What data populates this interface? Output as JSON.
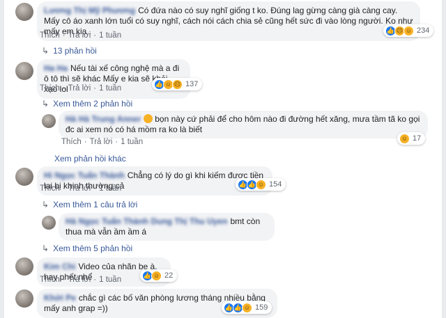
{
  "labels": {
    "like": "Thích",
    "reply": "Trả lời",
    "dot": "·"
  },
  "comments": [
    {
      "name": "Lương Thị Mỹ Phương",
      "text": "Có đứa nào có suy nghĩ giống t ko. Đúng lag gừng càng già càng cay. Mấy cô áo xanh lớn tuổi có suy nghĩ, cách nói cách chia sẻ cũng hết sức đi vào lòng người. Ko như mấy em kia .",
      "time": "1 tuần",
      "reactions": "234"
    },
    {
      "name": "Ha Ha",
      "text": "Nếu tài xế công nghệ mà a đi ô tô thì sẽ khác Mấy e kia sẽ khỏi xạo lol",
      "time": "1 tuần",
      "reactions": "137"
    },
    {
      "name": "Hi Ngọc Tuấn Thành",
      "text": "Chẳng có lý do gì khi kiếm được tiền lại bị khinh thường cả",
      "time": "1 tuần",
      "reactions": "154"
    },
    {
      "name": "Kim Chi",
      "text": "Video của nhãn be à, hay phết nhể",
      "time": "1 tuần",
      "reactions": "22"
    },
    {
      "name": "Khởi Pe",
      "text": "chắc gì các bố văn phòng lương tháng nhiều bằng mấy anh grap =))",
      "time": "1 tuần",
      "reactions": "159"
    }
  ],
  "replies": [
    {
      "name": "Hà Hà Trung Anner",
      "text": "bọn này cứ phải để cho hôm nào đi đường hết xăng, mưa tầm tã ko gọi đc ai xem nó có há mồm ra ko là biết",
      "time": "1 tuần",
      "reactions": "17"
    },
    {
      "name": "Hà Ngọc Tuấn Thành Dung Thị Thu Uyen",
      "text": "bmt còn thua mà vẫn ầm ầm á",
      "time": "",
      "reactions": ""
    }
  ],
  "links": {
    "replies_13": "13 phản hồi",
    "see_more_2": "Xem thêm 2 phản hồi",
    "see_other_replies": "Xem phản hồi khác",
    "see_more_1": "Xem thêm 1 câu trả lời",
    "see_more_5": "Xem thêm 5 phản hồi"
  },
  "colors": {
    "link": "#385898",
    "bubble": "#f2f3f5",
    "like": "#1877f2",
    "haha": "#f7b125"
  }
}
